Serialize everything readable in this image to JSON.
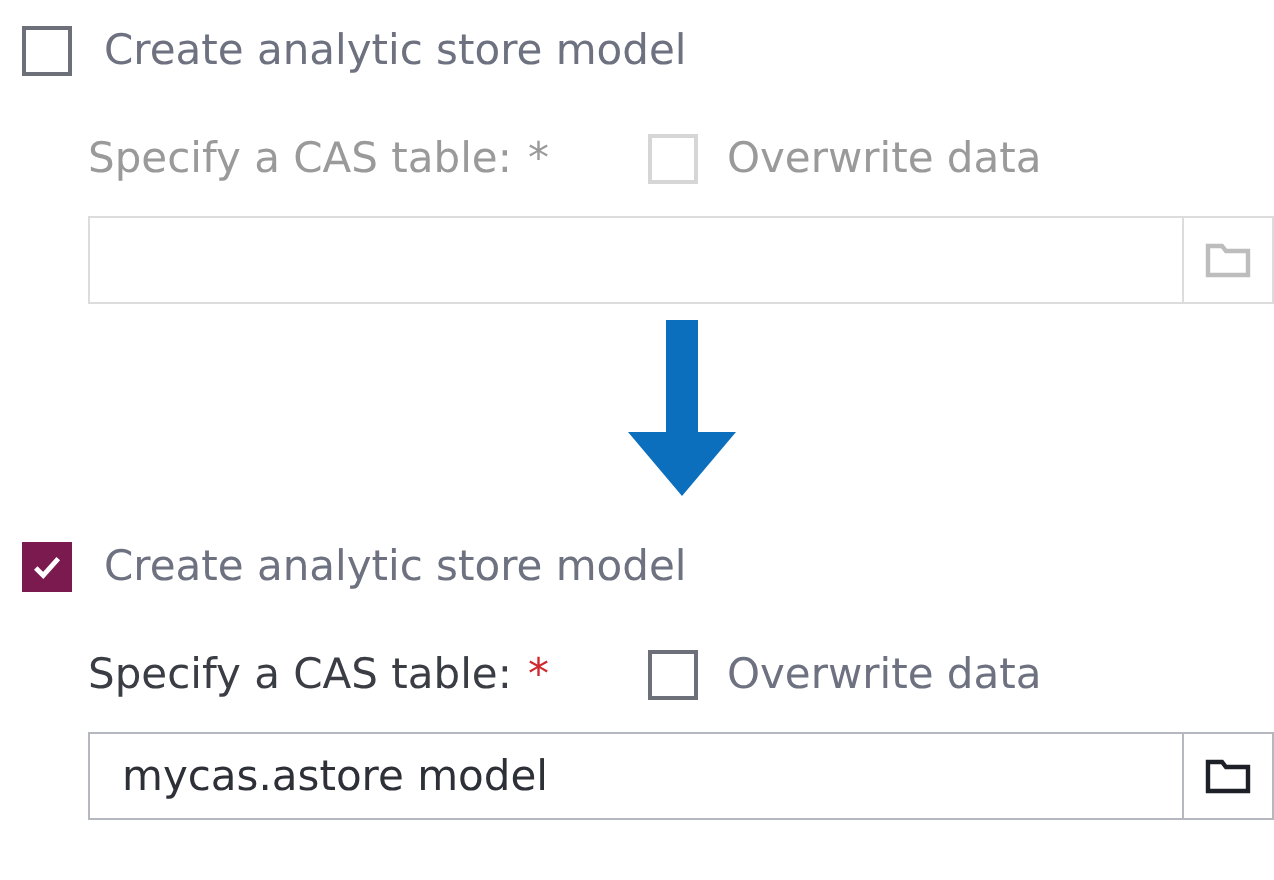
{
  "panels": [
    {
      "disabled": true,
      "create_model": {
        "label": "Create analytic store model",
        "checked": false
      },
      "table_label": "Specify a CAS table:",
      "required_mark": "*",
      "overwrite": {
        "label": "Overwrite data",
        "checked": false
      }
    },
    {
      "disabled": false,
      "create_model": {
        "label": "Create analytic store model",
        "checked": true
      },
      "table_label": "Specify a CAS table:",
      "required_mark": "*",
      "overwrite": {
        "label": "Overwrite data",
        "checked": false
      },
      "table_value": "mycas.astore model"
    }
  ]
}
